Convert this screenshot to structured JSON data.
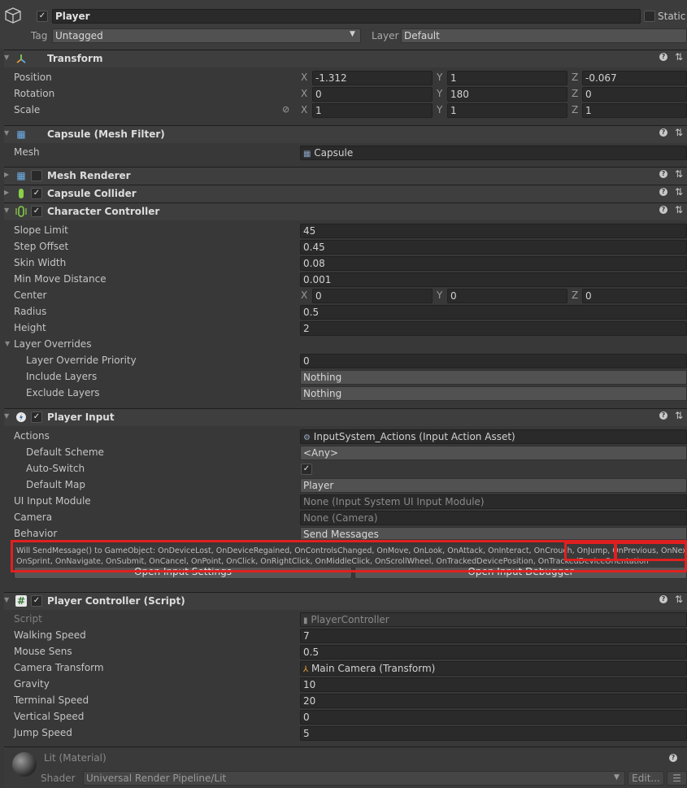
{
  "gameobject": {
    "name": "Player",
    "static_label": "Static",
    "tag_label": "Tag",
    "tag_value": "Untagged",
    "layer_label": "Layer",
    "layer_value": "Default"
  },
  "transform": {
    "title": "Transform",
    "rows": [
      {
        "label": "Position",
        "x": "-1.312",
        "y": "1",
        "z": "-0.067"
      },
      {
        "label": "Rotation",
        "x": "0",
        "y": "180",
        "z": "0"
      },
      {
        "label": "Scale",
        "x": "1",
        "y": "1",
        "z": "1"
      }
    ],
    "axis": {
      "x": "X",
      "y": "Y",
      "z": "Z"
    }
  },
  "mesh_filter": {
    "title": "Capsule (Mesh Filter)",
    "mesh_label": "Mesh",
    "mesh_value": "Capsule"
  },
  "mesh_renderer": {
    "title": "Mesh Renderer"
  },
  "capsule_collider": {
    "title": "Capsule Collider"
  },
  "character_controller": {
    "title": "Character Controller",
    "slope_limit": {
      "label": "Slope Limit",
      "value": "45"
    },
    "step_offset": {
      "label": "Step Offset",
      "value": "0.45"
    },
    "skin_width": {
      "label": "Skin Width",
      "value": "0.08"
    },
    "min_move": {
      "label": "Min Move Distance",
      "value": "0.001"
    },
    "center": {
      "label": "Center",
      "x": "0",
      "y": "0",
      "z": "0"
    },
    "radius": {
      "label": "Radius",
      "value": "0.5"
    },
    "height": {
      "label": "Height",
      "value": "2"
    },
    "layer_overrides": {
      "label": "Layer Overrides"
    },
    "priority": {
      "label": "Layer Override Priority",
      "value": "0"
    },
    "include": {
      "label": "Include Layers",
      "value": "Nothing"
    },
    "exclude": {
      "label": "Exclude Layers",
      "value": "Nothing"
    }
  },
  "player_input": {
    "title": "Player Input",
    "actions": {
      "label": "Actions",
      "value": "InputSystem_Actions (Input Action Asset)"
    },
    "default_scheme": {
      "label": "Default Scheme",
      "value": "<Any>"
    },
    "auto_switch": {
      "label": "Auto-Switch"
    },
    "default_map": {
      "label": "Default Map",
      "value": "Player"
    },
    "ui_module": {
      "label": "UI Input Module",
      "value": "None (Input System UI Input Module)"
    },
    "camera": {
      "label": "Camera",
      "value": "None (Camera)"
    },
    "behavior": {
      "label": "Behavior",
      "value": "Send Messages"
    },
    "message_line1": "Will SendMessage() to GameObject: OnDeviceLost, OnDeviceRegained, OnControlsChanged, OnMove, OnLook, OnAttack, OnInteract, OnCrouch, OnJump, OnPrevious, OnNext,",
    "message_line2": "OnSprint, OnNavigate, OnSubmit, OnCancel, OnPoint, OnClick, OnRightClick, OnMiddleClick, OnScrollWheel, OnTrackedDevicePosition, OnTrackedDeviceOrientation",
    "open_settings": "Open Input Settings",
    "open_debugger": "Open Input Debugger"
  },
  "player_controller": {
    "title": "Player Controller (Script)",
    "script": {
      "label": "Script",
      "value": "PlayerController"
    },
    "walking_speed": {
      "label": "Walking Speed",
      "value": "7"
    },
    "mouse_sens": {
      "label": "Mouse Sens",
      "value": "0.5"
    },
    "camera_transform": {
      "label": "Camera Transform",
      "value": "Main Camera (Transform)"
    },
    "gravity": {
      "label": "Gravity",
      "value": "10"
    },
    "terminal_speed": {
      "label": "Terminal Speed",
      "value": "20"
    },
    "vertical_speed": {
      "label": "Vertical Speed",
      "value": "0"
    },
    "jump_speed": {
      "label": "Jump Speed",
      "value": "5"
    }
  },
  "material": {
    "title": "Lit (Material)",
    "shader_label": "Shader",
    "shader_value": "Universal Render Pipeline/Lit",
    "edit_label": "Edit..."
  },
  "icons": {
    "help": "?",
    "settings": "⇅",
    "check": "✓"
  },
  "colors": {
    "highlight": "#e02020",
    "background": "#383838"
  }
}
